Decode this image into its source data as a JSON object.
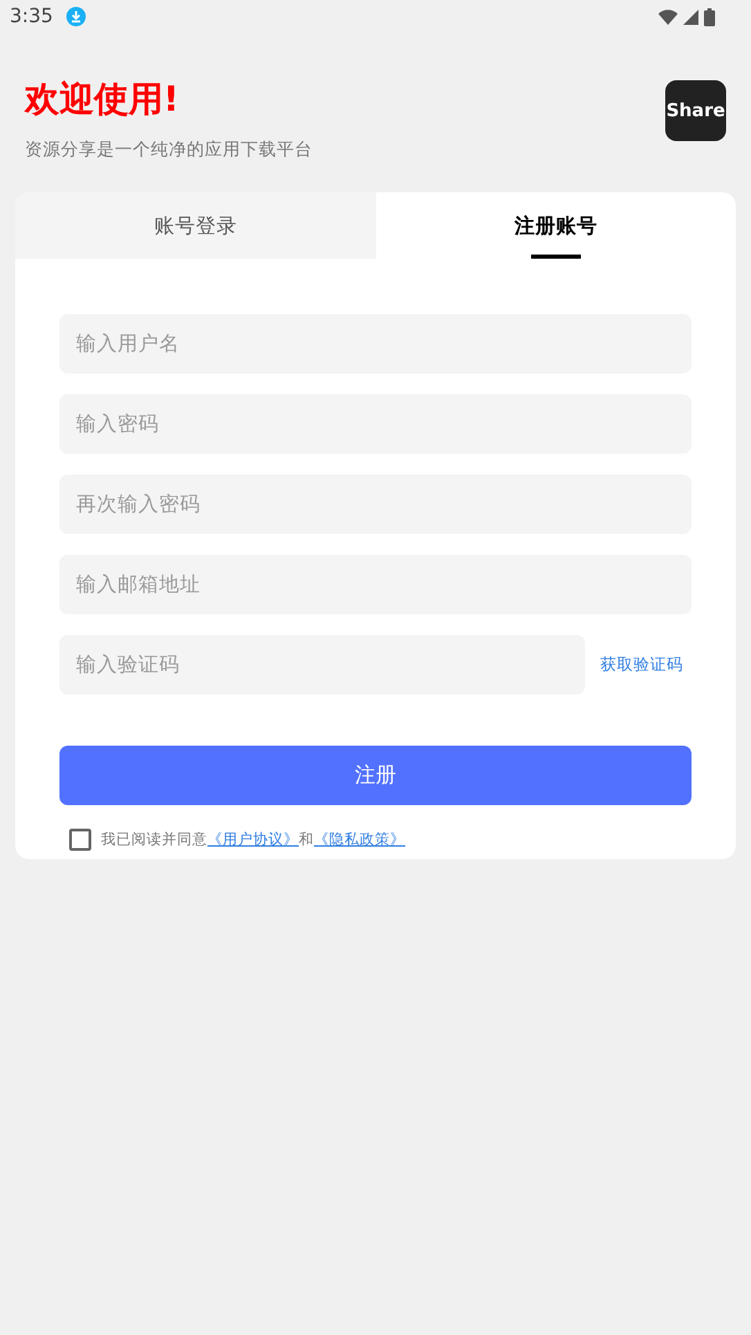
{
  "status_bar": {
    "time": "3:35"
  },
  "header": {
    "title": "欢迎使用!",
    "subtitle": "资源分享是一个纯净的应用下载平台",
    "logo_text": "Share"
  },
  "tabs": [
    {
      "label": "账号登录",
      "selected": false
    },
    {
      "label": "注册账号",
      "selected": true
    }
  ],
  "fields": [
    {
      "placeholder": "输入用户名"
    },
    {
      "placeholder": "输入密码"
    },
    {
      "placeholder": "再次输入密码"
    },
    {
      "placeholder": "输入邮箱地址"
    }
  ],
  "code_field": {
    "placeholder": "输入验证码",
    "link": "获取验证码"
  },
  "submit": "注册",
  "agreement": {
    "checked": false,
    "text": "我已阅读并同意",
    "link1": "《用户协议》",
    "joiner": "和",
    "link2": "《隐私政策》"
  }
}
